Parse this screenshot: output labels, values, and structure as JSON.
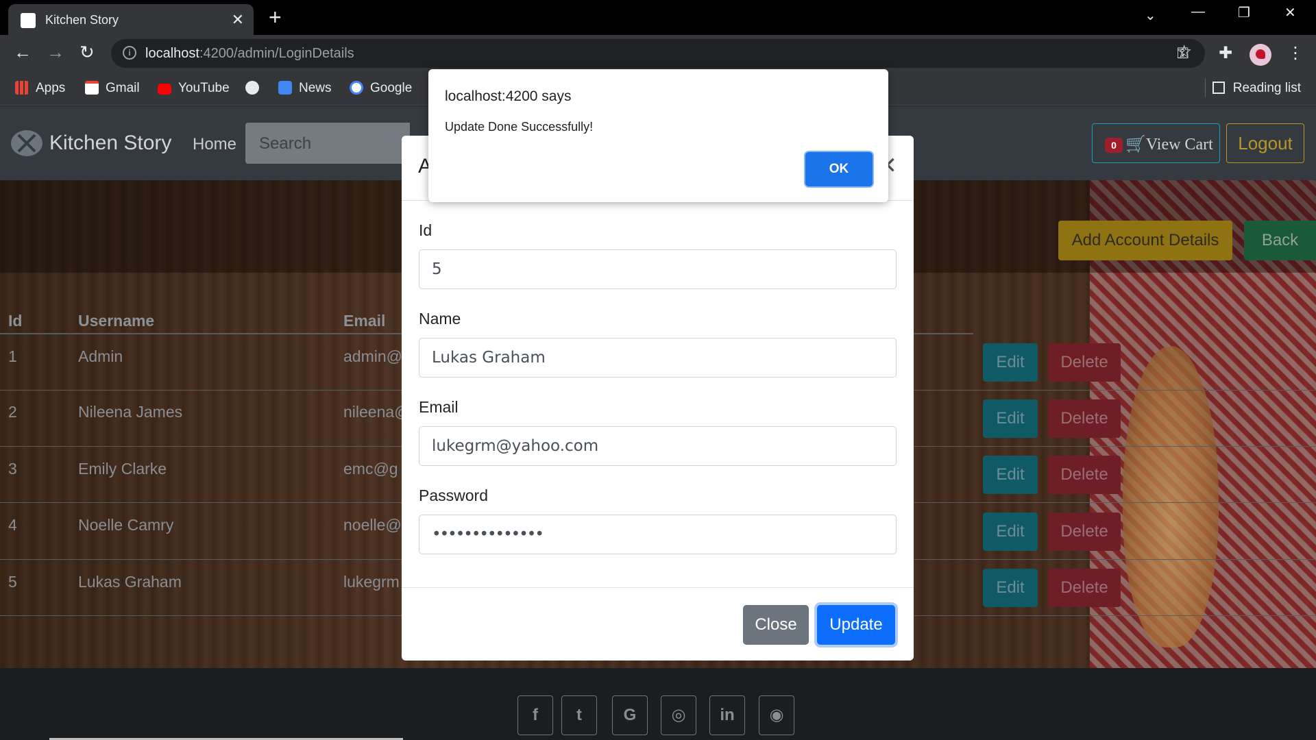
{
  "browser": {
    "tab_title": "Kitchen Story",
    "url_host": "localhost",
    "url_rest": ":4200/admin/LoginDetails",
    "bookmarks": [
      {
        "label": "Apps",
        "icon": "apps-grid-icon",
        "color": "#ea4335"
      },
      {
        "label": "Gmail",
        "icon": "gmail-icon",
        "color": "#ea4335"
      },
      {
        "label": "YouTube",
        "icon": "youtube-icon",
        "color": "#ff0000"
      },
      {
        "label": "",
        "icon": "globe-icon",
        "color": "#e8eaed"
      },
      {
        "label": "News",
        "icon": "news-icon",
        "color": "#4285f4"
      },
      {
        "label": "Google",
        "icon": "google-icon",
        "color": "#ffffff"
      }
    ],
    "reading_list": "Reading list"
  },
  "navbar": {
    "brand": "Kitchen Story",
    "home": "Home",
    "search_placeholder": "Search",
    "cart_count": "0",
    "view_cart": "View Cart",
    "logout": "Logout"
  },
  "actions": {
    "add_account": "Add Account Details",
    "back": "Back"
  },
  "table": {
    "headers": [
      "Id",
      "Username",
      "Email"
    ],
    "rows": [
      {
        "id": "1",
        "username": "Admin",
        "email": "admin@"
      },
      {
        "id": "2",
        "username": "Nileena James",
        "email": "nileena@"
      },
      {
        "id": "3",
        "username": "Emily Clarke",
        "email": "emc@g"
      },
      {
        "id": "4",
        "username": "Noelle Camry",
        "email": "noelle@"
      },
      {
        "id": "5",
        "username": "Lukas Graham",
        "email": "lukegrm"
      }
    ],
    "edit_label": "Edit",
    "delete_label": "Delete"
  },
  "modal": {
    "title_visible": "A",
    "fields": [
      {
        "label": "Id",
        "value": "5"
      },
      {
        "label": "Name",
        "value": "Lukas Graham"
      },
      {
        "label": "Email",
        "value": "lukegrm@yahoo.com"
      },
      {
        "label": "Password",
        "value": "••••••••••••••"
      }
    ],
    "close": "Close",
    "update": "Update"
  },
  "alert": {
    "origin": "localhost:4200 says",
    "message": "Update Done Successfully!",
    "ok": "OK"
  },
  "footer": {
    "social": [
      {
        "glyph": "f",
        "icon": "facebook-icon"
      },
      {
        "glyph": "t",
        "icon": "twitter-icon"
      },
      {
        "glyph": "G",
        "icon": "google-icon"
      },
      {
        "glyph": "◎",
        "icon": "instagram-icon"
      },
      {
        "glyph": "in",
        "icon": "linkedin-icon"
      },
      {
        "glyph": "◉",
        "icon": "github-icon"
      }
    ]
  }
}
